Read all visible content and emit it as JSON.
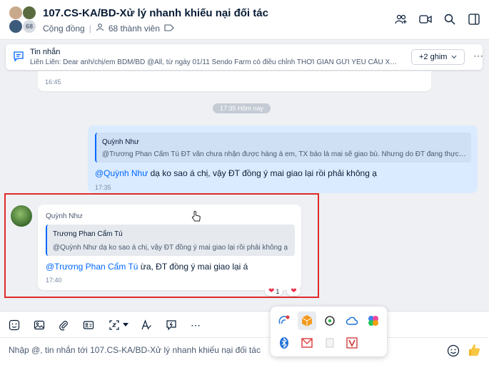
{
  "header": {
    "title": "107.CS-KA/BD-Xử lý nhanh khiếu nại đối tác",
    "category": "Cộng đồng",
    "members": "68 thành viên",
    "avatar_count": "68"
  },
  "pinned": {
    "label": "Tin nhắn",
    "text": "Liên Liên: Dear anh/chị/em BDM/BD @All, từ ngày 01/11 Sendo Farm có điều chỉnh THỜI GIAN GỬI YÊU CẦU XỬ LÝ",
    "ghim_label": "+2 ghim"
  },
  "messages": {
    "prev_time": "16:45",
    "time_divider": "17:35 Hôm nay",
    "me": {
      "quote_name": "Quỳnh Như",
      "quote_text": "@Trương Phan Cẩm Tú ĐT vẫn chưa nhận được hàng á em, TX báo là mai sẽ giao bù. Nhưng do ĐT đang thực hiện",
      "mention": "@Quỳnh Như",
      "text": " dạ ko sao á chị, vậy ĐT đồng ý mai giao lại rồi phải không ạ",
      "time": "17:35"
    },
    "other": {
      "sender": "Quỳnh Như",
      "quote_name": "Trương Phan Cẩm Tú",
      "quote_text": "@Quỳnh Như dạ ko sao á chị, vậy ĐT đồng ý mai giao lại rồi phải không ạ",
      "mention": "@Trương Phan Cẩm Tú",
      "text": " ừa, ĐT đồng ý mai giao lại á",
      "time": "17:40",
      "reaction_count": "1"
    }
  },
  "input": {
    "placeholder": "Nhập @, tin nhắn tới 107.CS-KA/BD-Xử lý nhanh khiếu nại đối tác"
  },
  "colors": {
    "accent": "#0068ff",
    "highlight_border": "#e02a2a",
    "my_bubble": "#dbebff"
  }
}
